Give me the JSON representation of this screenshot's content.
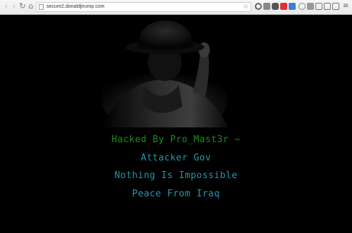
{
  "browser": {
    "url": "secure2.donaldjtrump.com"
  },
  "page": {
    "messages": [
      {
        "text": "Hacked By Pro_Mast3r ~",
        "color": "#1a8f1a"
      },
      {
        "text": "Attacker Gov",
        "color": "#1f9aa8"
      },
      {
        "text": "Nothing Is Impossible",
        "color": "#1f9aa8"
      },
      {
        "text": "Peace From Iraq",
        "color": "#1f9aa8"
      }
    ]
  },
  "icons": {
    "back": "back-arrow-icon",
    "forward": "forward-arrow-icon",
    "reload": "reload-icon",
    "home": "home-icon",
    "bookmark": "star-icon",
    "menu": "menu-icon"
  }
}
